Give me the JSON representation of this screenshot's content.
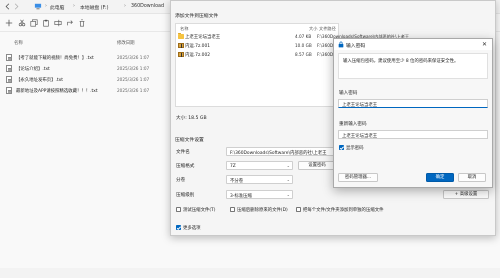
{
  "explorer": {
    "breadcrumbs": [
      "此电脑",
      "本地磁盘 (F:)",
      "360Download"
    ],
    "columns": {
      "name": "名称",
      "date": "修改日期"
    },
    "files": [
      {
        "name": "【考了就能下载的视频！尚免费！】.txt",
        "date": "2025/3/26 1:07"
      },
      {
        "name": "【论坛介绍】.txt",
        "date": "2025/3/26 1:07"
      },
      {
        "name": "【永久地址发布页】.txt",
        "date": "2025/3/26 1:07"
      },
      {
        "name": "最新地址及APP请按照精选收藏！！！.txt",
        "date": "2025/3/26 1:07"
      }
    ]
  },
  "archive": {
    "section_files": "添加文件到压缩文件",
    "list_head": {
      "name": "名称",
      "size": "大小",
      "path": "文件路径"
    },
    "items": [
      {
        "name": "上老王论坛当老王",
        "size": "4.07 KB",
        "path": "F:\\360Downloads\\Software\\内部恶的社\\上老王"
      },
      {
        "name": "内运.7z.001",
        "size": "10.0 GB",
        "path": "F:\\360Downloads\\Software\\内部恶的社"
      },
      {
        "name": "内运.7z.002",
        "size": "8.57 GB",
        "path": "F:\\360Downloads\\Software\\内部恶的社"
      }
    ],
    "total": "大小: 18.5 GB",
    "section_settings": "压缩文件设置",
    "filename_label": "文件名",
    "filename_value": "F:\\360Downloads\\Software\\内部恶的社\\上老王",
    "format_label": "压缩格式",
    "format_value": "7Z",
    "set_password_btn": "设置密码",
    "volume_label": "分卷",
    "volume_value": "不分卷",
    "level_label": "压缩级别",
    "level_value": "3-标准压缩",
    "advanced_btn": "+ 高级设置",
    "opt_test": "测试压缩文件(T)",
    "opt_delete": "压缩后删除原来的文件(D)",
    "opt_each": "把每个文件/文件夹添加到单独的压缩文件",
    "more_options": "更多选项"
  },
  "password": {
    "title": "输入密码",
    "close": "✕",
    "info": "输入压缩包密码，建议使用至少 8 位的密码来保证安全性。",
    "enter_label": "输入密码",
    "enter_value": "上老王论坛当老王",
    "reenter_label": "重新输入密码",
    "reenter_value": "上老王论坛当老王",
    "show_label": "显示密码",
    "manager_btn": "密码管理器...",
    "ok_btn": "确定",
    "cancel_btn": "取消"
  }
}
